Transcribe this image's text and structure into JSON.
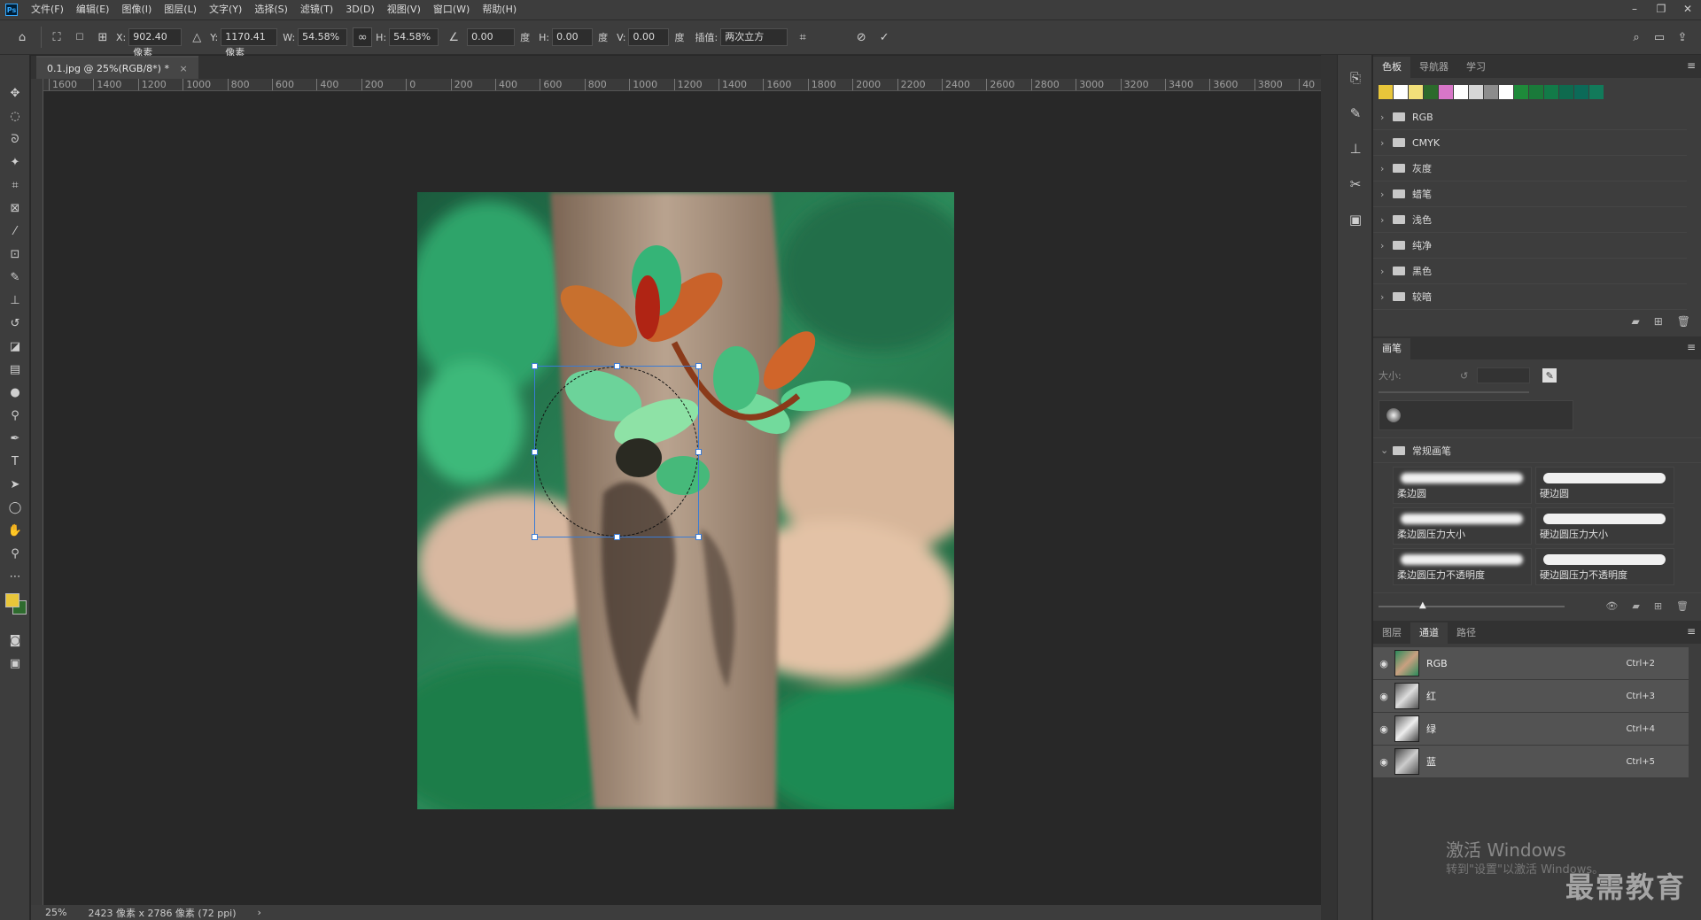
{
  "app": {
    "logo": "Ps"
  },
  "menu": [
    "文件(F)",
    "编辑(E)",
    "图像(I)",
    "图层(L)",
    "文字(Y)",
    "选择(S)",
    "滤镜(T)",
    "3D(D)",
    "视图(V)",
    "窗口(W)",
    "帮助(H)"
  ],
  "window_controls": [
    "–",
    "❐",
    "✕"
  ],
  "options": {
    "x_label": "X:",
    "x_value": "902.40 像素",
    "y_label": "Y:",
    "y_value": "1170.41 像素",
    "w_label": "W:",
    "w_value": "54.58%",
    "h_label": "H:",
    "h_value": "54.58%",
    "angle_value": "0.00",
    "angle_unit": "度",
    "hskew_label": "H:",
    "hskew_value": "0.00",
    "hskew_unit": "度",
    "vskew_label": "V:",
    "vskew_value": "0.00",
    "vskew_unit": "度",
    "interp_label": "插值:",
    "interp_value": "两次立方"
  },
  "document": {
    "tab_title": "0.1.jpg @ 25%(RGB/8*) *",
    "tab_close": "×"
  },
  "ruler": {
    "h_ticks": [
      "1600",
      "1400",
      "1200",
      "1000",
      "800",
      "600",
      "400",
      "200",
      "0",
      "200",
      "400",
      "600",
      "800",
      "1000",
      "1200",
      "1400",
      "1600",
      "1800",
      "2000",
      "2200",
      "2400",
      "2600",
      "2800",
      "3000",
      "3200",
      "3400",
      "3600",
      "3800",
      "40"
    ]
  },
  "status": {
    "zoom": "25%",
    "doc_info": "2423 像素 x 2786 像素 (72 ppi)",
    "arrow": "›"
  },
  "swatches_panel": {
    "tabs": [
      "色板",
      "导航器",
      "学习"
    ],
    "colors": [
      "#e8c63a",
      "#ffffff",
      "#f2e07a",
      "#2c6a2c",
      "#d876c8",
      "#ffffff",
      "#d6d6d6",
      "#8c8c8c",
      "#ffffff",
      "#1e8a3a",
      "#1a7a3a",
      "#127a48",
      "#0e6a4e",
      "#0c6a58",
      "#127a5a"
    ],
    "groups": [
      "RGB",
      "CMYK",
      "灰度",
      "蜡笔",
      "浅色",
      "纯净",
      "黑色",
      "较暗"
    ]
  },
  "brush_panel": {
    "tab": "画笔",
    "size_label": "大小:",
    "folder": "常规画笔",
    "brushes": [
      {
        "name": "柔边圆",
        "soft": true
      },
      {
        "name": "硬边圆",
        "soft": false
      },
      {
        "name": "柔边圆压力大小",
        "soft": true
      },
      {
        "name": "硬边圆压力大小",
        "soft": false
      },
      {
        "name": "柔边圆压力不透明度",
        "soft": true
      },
      {
        "name": "硬边圆压力不透明度",
        "soft": false
      }
    ]
  },
  "channels_panel": {
    "tabs": [
      "图层",
      "通道",
      "路径"
    ],
    "channels": [
      {
        "name": "RGB",
        "shortcut": "Ctrl+2"
      },
      {
        "name": "红",
        "shortcut": "Ctrl+3"
      },
      {
        "name": "绿",
        "shortcut": "Ctrl+4"
      },
      {
        "name": "蓝",
        "shortcut": "Ctrl+5"
      }
    ]
  },
  "watermark": {
    "line1": "激活 Windows",
    "line2": "转到\"设置\"以激活 Windows。",
    "brand": "最需教育"
  }
}
